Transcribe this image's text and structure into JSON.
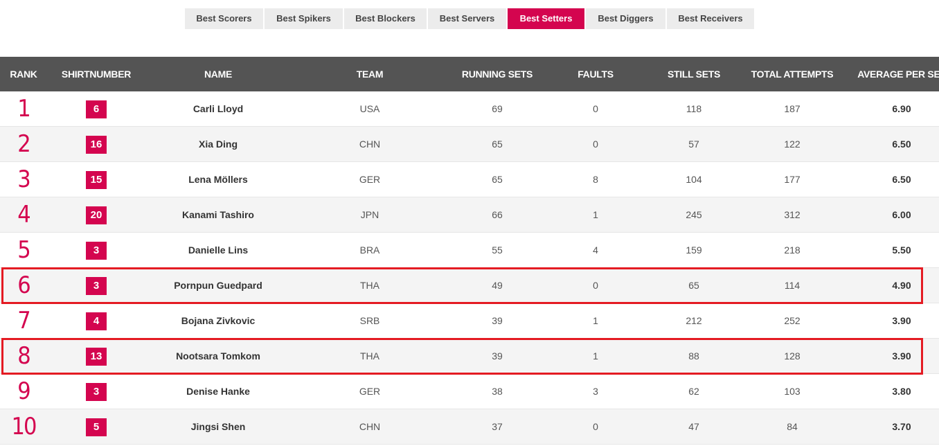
{
  "tabs": [
    {
      "label": "Best Scorers",
      "active": false
    },
    {
      "label": "Best Spikers",
      "active": false
    },
    {
      "label": "Best Blockers",
      "active": false
    },
    {
      "label": "Best Servers",
      "active": false
    },
    {
      "label": "Best Setters",
      "active": true
    },
    {
      "label": "Best Diggers",
      "active": false
    },
    {
      "label": "Best Receivers",
      "active": false
    }
  ],
  "columns": {
    "rank": "RANK",
    "shirt": "SHIRTNUMBER",
    "name": "NAME",
    "team": "TEAM",
    "running": "RUNNING SETS",
    "faults": "FAULTS",
    "still": "STILL SETS",
    "attempts": "TOTAL ATTEMPTS",
    "avg": "AVERAGE PER SET"
  },
  "rows": [
    {
      "rank": "1",
      "shirt": "6",
      "name": "Carli Lloyd",
      "team": "USA",
      "running": "69",
      "faults": "0",
      "still": "118",
      "attempts": "187",
      "avg": "6.90",
      "highlighted": false
    },
    {
      "rank": "2",
      "shirt": "16",
      "name": "Xia Ding",
      "team": "CHN",
      "running": "65",
      "faults": "0",
      "still": "57",
      "attempts": "122",
      "avg": "6.50",
      "highlighted": false
    },
    {
      "rank": "3",
      "shirt": "15",
      "name": "Lena Möllers",
      "team": "GER",
      "running": "65",
      "faults": "8",
      "still": "104",
      "attempts": "177",
      "avg": "6.50",
      "highlighted": false
    },
    {
      "rank": "4",
      "shirt": "20",
      "name": "Kanami Tashiro",
      "team": "JPN",
      "running": "66",
      "faults": "1",
      "still": "245",
      "attempts": "312",
      "avg": "6.00",
      "highlighted": false
    },
    {
      "rank": "5",
      "shirt": "3",
      "name": "Danielle Lins",
      "team": "BRA",
      "running": "55",
      "faults": "4",
      "still": "159",
      "attempts": "218",
      "avg": "5.50",
      "highlighted": false
    },
    {
      "rank": "6",
      "shirt": "3",
      "name": "Pornpun Guedpard",
      "team": "THA",
      "running": "49",
      "faults": "0",
      "still": "65",
      "attempts": "114",
      "avg": "4.90",
      "highlighted": true
    },
    {
      "rank": "7",
      "shirt": "4",
      "name": "Bojana Zivkovic",
      "team": "SRB",
      "running": "39",
      "faults": "1",
      "still": "212",
      "attempts": "252",
      "avg": "3.90",
      "highlighted": false
    },
    {
      "rank": "8",
      "shirt": "13",
      "name": "Nootsara Tomkom",
      "team": "THA",
      "running": "39",
      "faults": "1",
      "still": "88",
      "attempts": "128",
      "avg": "3.90",
      "highlighted": true
    },
    {
      "rank": "9",
      "shirt": "3",
      "name": "Denise Hanke",
      "team": "GER",
      "running": "38",
      "faults": "3",
      "still": "62",
      "attempts": "103",
      "avg": "3.80",
      "highlighted": false
    },
    {
      "rank": "10",
      "shirt": "5",
      "name": "Jingsi Shen",
      "team": "CHN",
      "running": "37",
      "faults": "0",
      "still": "47",
      "attempts": "84",
      "avg": "3.70",
      "highlighted": false
    }
  ],
  "colors": {
    "accent": "#d4054f",
    "header_bg": "#545454",
    "highlight_border": "#e41b23"
  }
}
